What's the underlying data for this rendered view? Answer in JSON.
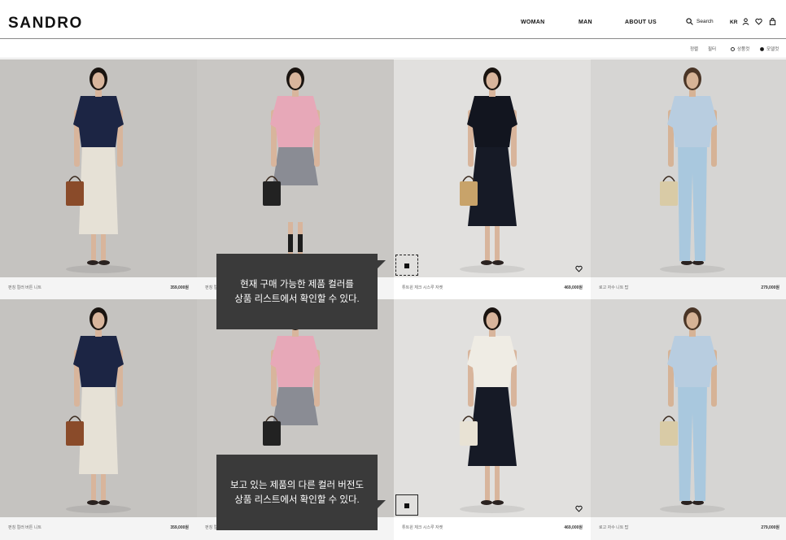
{
  "header": {
    "logo": "SANDRO",
    "nav": [
      "WOMAN",
      "MAN",
      "ABOUT US"
    ],
    "search_label": "Search",
    "lang": "KR"
  },
  "toolbar": {
    "sort": "정렬",
    "filter": "필터",
    "view_product": "상품컷",
    "view_model": "모델컷",
    "selected_view": "모델컷"
  },
  "products": [
    {
      "name": "펀칭 컬러 버튼 니트",
      "price": "359,000원",
      "bg": "#c5c3c0",
      "top": "#1c2544",
      "bottom": "#e6e1d6",
      "bottomType": "skirt",
      "hair": "#1a1410",
      "skin": "#d8b59c",
      "bag": "#8a4b2a",
      "showPrice": true
    },
    {
      "name": "펀칭 컬러 버튼 니트",
      "price": "",
      "bg": "#c9c7c4",
      "top": "#e7a8b8",
      "bottom": "#8a8c94",
      "bottomType": "mini",
      "hair": "#1a1410",
      "skin": "#d8b59c",
      "bag": "#222222",
      "showPrice": false
    },
    {
      "name": "튜트윈 체크 시스루 자켓",
      "price": "469,000원",
      "bg": "#e1e0de",
      "top": "#12151f",
      "bottom": "#161a26",
      "bottomType": "long",
      "hair": "#1a1410",
      "skin": "#d8b59c",
      "bag": "#c8a36a",
      "showPrice": true
    },
    {
      "name": "로고 자수 니트 탑",
      "price": "279,000원",
      "bg": "#d6d5d3",
      "top": "#b8cde0",
      "bottom": "#a9c8de",
      "bottomType": "pants",
      "hair": "#4a3526",
      "skin": "#d6b396",
      "bag": "#d9cba6",
      "showPrice": true
    },
    {
      "name": "펀칭 컬러 버튼 니트",
      "price": "359,000원",
      "bg": "#c5c3c0",
      "top": "#1c2544",
      "bottom": "#e6e1d6",
      "bottomType": "skirt",
      "hair": "#1a1410",
      "skin": "#d8b59c",
      "bag": "#8a4b2a",
      "showPrice": true
    },
    {
      "name": "펀칭 컬러 버튼 니트",
      "price": "",
      "bg": "#c9c7c4",
      "top": "#e7a8b8",
      "bottom": "#8a8c94",
      "bottomType": "mini",
      "hair": "#1a1410",
      "skin": "#d8b59c",
      "bag": "#222222",
      "showPrice": false
    },
    {
      "name": "튜트윈 체크 시스루 자켓",
      "price": "469,000원",
      "bg": "#e1e0de",
      "top": "#efece4",
      "bottom": "#161a26",
      "bottomType": "long",
      "hair": "#1a1410",
      "skin": "#d8b59c",
      "bag": "#e8e2d4",
      "showPrice": true
    },
    {
      "name": "로고 자수 니트 탑",
      "price": "279,000원",
      "bg": "#d6d5d3",
      "top": "#b8cde0",
      "bottom": "#a9c8de",
      "bottomType": "pants",
      "hair": "#4a3526",
      "skin": "#d6b396",
      "bag": "#d9cba6",
      "showPrice": true
    }
  ],
  "tooltips": [
    {
      "line1": "현재 구매 가능한 제품 컬러를",
      "line2": "상품 리스트에서 확인할 수 있다."
    },
    {
      "line1": "보고 있는 제품의 다른 컬러 버전도",
      "line2": "상품 리스트에서 확인할 수 있다."
    }
  ],
  "colors": {
    "accent": "#111111",
    "tooltip_bg": "#3a3a3a"
  }
}
